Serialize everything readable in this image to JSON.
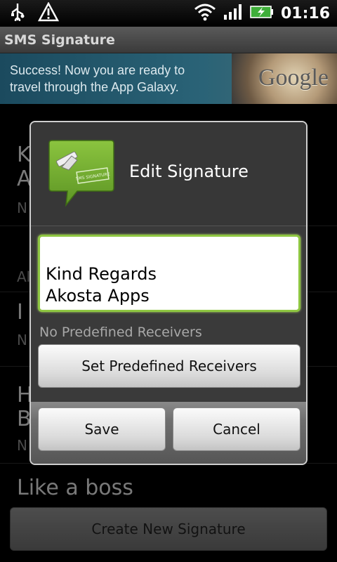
{
  "status_bar": {
    "time": "01:16"
  },
  "app": {
    "title": "SMS Signature"
  },
  "ad": {
    "line1": "Success! Now you are ready to",
    "line2": "travel through the App Galaxy.",
    "logo": "Google"
  },
  "list": {
    "items": [
      {
        "title_1": "K",
        "title_2": "A",
        "sub": "N"
      },
      {
        "title_1": "",
        "title_2": "",
        "sub": "Al"
      },
      {
        "title_1": "I",
        "title_2": "",
        "sub": "N"
      },
      {
        "title_1": "H",
        "title_2": "B",
        "sub": "N"
      },
      {
        "title_1": "Like a boss",
        "title_2": "",
        "sub": ""
      }
    ],
    "create_label": "Create New Signature"
  },
  "dialog": {
    "title": "Edit Signature",
    "icon_label": "SMS SIGNATURE",
    "signature_text": "Kind Regards\nAkosta Apps",
    "receivers_status": "No Predefined Receivers",
    "set_receivers_label": "Set Predefined Receivers",
    "save_label": "Save",
    "cancel_label": "Cancel"
  },
  "colors": {
    "accent_green": "#8ec641",
    "icon_green": "#6fa82e"
  }
}
